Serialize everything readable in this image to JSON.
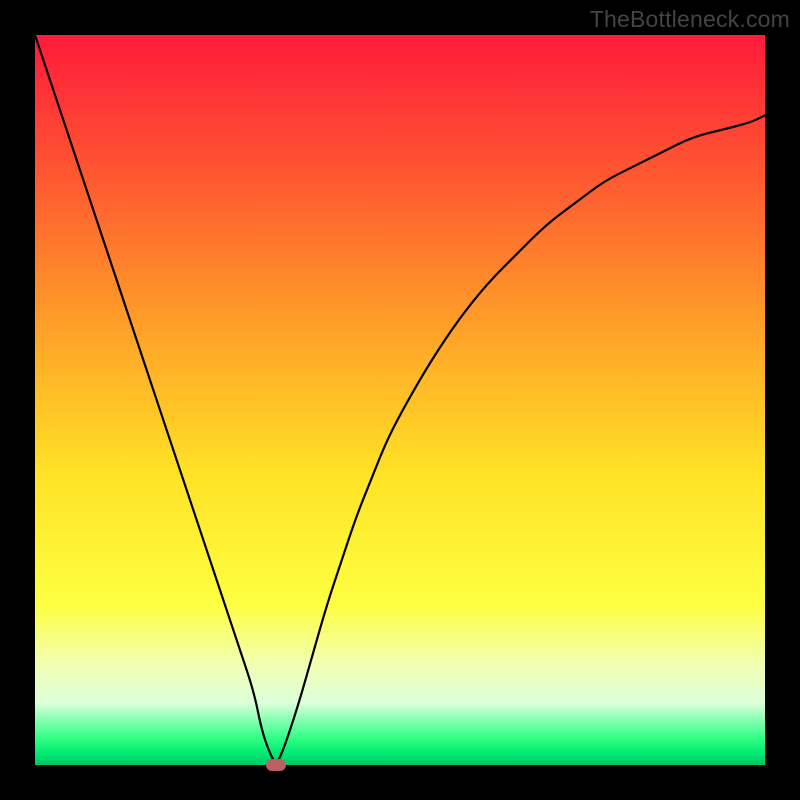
{
  "watermark": {
    "text": "TheBottleneck.com"
  },
  "chart_data": {
    "type": "line",
    "title": "",
    "xlabel": "",
    "ylabel": "",
    "x": [
      0.0,
      0.02,
      0.04,
      0.06,
      0.08,
      0.1,
      0.12,
      0.14,
      0.16,
      0.18,
      0.2,
      0.22,
      0.24,
      0.26,
      0.28,
      0.3,
      0.31,
      0.32,
      0.33,
      0.34,
      0.36,
      0.38,
      0.4,
      0.42,
      0.44,
      0.46,
      0.48,
      0.5,
      0.54,
      0.58,
      0.62,
      0.66,
      0.7,
      0.74,
      0.78,
      0.82,
      0.86,
      0.9,
      0.94,
      0.98,
      1.0
    ],
    "y": [
      1.0,
      0.94,
      0.88,
      0.82,
      0.76,
      0.7,
      0.64,
      0.58,
      0.52,
      0.46,
      0.4,
      0.34,
      0.28,
      0.22,
      0.16,
      0.1,
      0.05,
      0.02,
      0.0,
      0.02,
      0.08,
      0.15,
      0.22,
      0.28,
      0.34,
      0.39,
      0.44,
      0.48,
      0.55,
      0.61,
      0.66,
      0.7,
      0.74,
      0.77,
      0.8,
      0.82,
      0.84,
      0.86,
      0.87,
      0.88,
      0.89
    ],
    "xlim": [
      0,
      1
    ],
    "ylim": [
      0,
      1
    ],
    "marker": {
      "x": 0.33,
      "y": 0.0,
      "color": "#bb6062"
    },
    "gradient_stops": [
      {
        "pos": 0.0,
        "color": "#ff1a3a"
      },
      {
        "pos": 0.2,
        "color": "#ff5a30"
      },
      {
        "pos": 0.4,
        "color": "#ffa028"
      },
      {
        "pos": 0.6,
        "color": "#ffe225"
      },
      {
        "pos": 0.78,
        "color": "#fdff40"
      },
      {
        "pos": 0.86,
        "color": "#f3ffb0"
      },
      {
        "pos": 0.915,
        "color": "#dcffda"
      },
      {
        "pos": 0.94,
        "color": "#80ffb0"
      },
      {
        "pos": 0.965,
        "color": "#2aff80"
      },
      {
        "pos": 0.985,
        "color": "#00e874"
      },
      {
        "pos": 1.0,
        "color": "#00c864"
      }
    ]
  }
}
